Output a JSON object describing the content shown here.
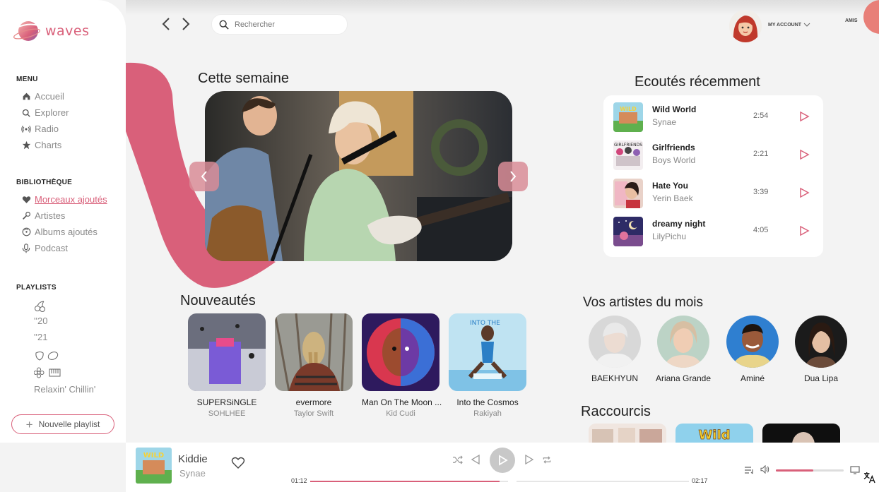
{
  "app": {
    "name": "waves"
  },
  "topbar": {
    "search_placeholder": "Rechercher",
    "account_label": "MY ACCOUNT",
    "friends_label": "AMIS"
  },
  "sidebar": {
    "menu_title": "MENU",
    "menu": [
      {
        "label": "Accueil",
        "icon": "home-icon"
      },
      {
        "label": "Explorer",
        "icon": "search-icon"
      },
      {
        "label": "Radio",
        "icon": "radio-icon"
      },
      {
        "label": "Charts",
        "icon": "star-icon"
      }
    ],
    "library_title": "BIBLIOTHÈQUE",
    "library": [
      {
        "label": "Morceaux ajoutés",
        "icon": "heart-icon",
        "active": true
      },
      {
        "label": "Artistes",
        "icon": "microphone-icon"
      },
      {
        "label": "Albums ajoutés",
        "icon": "vinyl-icon"
      },
      {
        "label": "Podcast",
        "icon": "podcast-icon"
      }
    ],
    "playlists_title": "PLAYLISTS",
    "playlists": [
      {
        "label": "",
        "icon": "cherries-icon"
      },
      {
        "label": "''20"
      },
      {
        "label": "''21"
      },
      {
        "label": "",
        "icon": "strawberry-lemon-icon"
      },
      {
        "label": "",
        "icon": "flower-piano-icon"
      },
      {
        "label": "Relaxin' Chillin'"
      }
    ],
    "new_playlist": "Nouvelle playlist"
  },
  "sections": {
    "this_week": "Cette semaine",
    "recent": "Ecoutés récemment",
    "new_releases": "Nouveautés",
    "artists_of_month": "Vos artistes du mois",
    "shortcuts": "Raccourcis"
  },
  "recent": [
    {
      "title": "Wild World",
      "artist": "Synae",
      "duration": "2:54"
    },
    {
      "title": "Girlfriends",
      "artist": "Boys World",
      "duration": "2:21"
    },
    {
      "title": "Hate You",
      "artist": "Yerin Baek",
      "duration": "3:39"
    },
    {
      "title": "dreamy night",
      "artist": "LilyPichu",
      "duration": "4:05"
    }
  ],
  "new_releases": [
    {
      "title": "SUPERSiNGLE",
      "artist": "SOHLHEE"
    },
    {
      "title": "evermore",
      "artist": "Taylor Swift"
    },
    {
      "title": "Man On The Moon ...",
      "artist": "Kid Cudi"
    },
    {
      "title": "Into the Cosmos",
      "artist": "Rakiyah"
    }
  ],
  "artists": [
    {
      "name": "BAEKHYUN"
    },
    {
      "name": "Ariana Grande"
    },
    {
      "name": "Aminé"
    },
    {
      "name": "Dua Lipa"
    }
  ],
  "player": {
    "title": "Kiddie",
    "artist": "Synae",
    "elapsed": "01:12",
    "total": "02:17",
    "progress": 0.5,
    "volume": 0.55
  },
  "colors": {
    "accent": "#d9607a",
    "background": "#f3f3f3"
  }
}
